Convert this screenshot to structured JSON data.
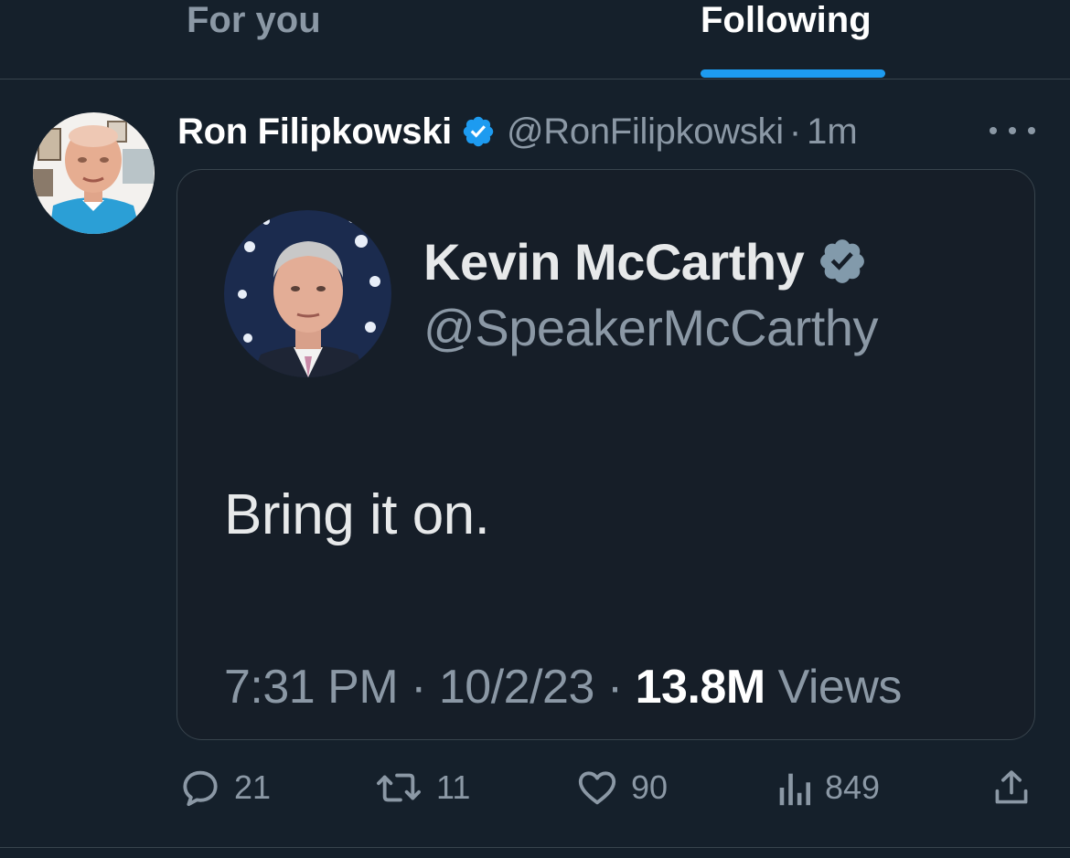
{
  "tabs": {
    "for_you": "For you",
    "following": "Following",
    "active": "following"
  },
  "tweet": {
    "author_name": "Ron Filipkowski",
    "author_handle": "@RonFilipkowski",
    "separator": "·",
    "time": "1m",
    "verified_icon": "verified-badge-icon",
    "more_icon": "more-options-icon"
  },
  "quoted_image": {
    "name": "Kevin McCarthy",
    "handle": "@SpeakerMcCarthy",
    "text": "Bring it on.",
    "time": "7:31 PM",
    "date": "10/2/23",
    "separator": "·",
    "views_count": "13.8M",
    "views_label": "Views"
  },
  "actions": {
    "reply_count": "21",
    "retweet_count": "11",
    "like_count": "90",
    "views_count": "849"
  },
  "colors": {
    "background": "#15202b",
    "accent": "#1d9bf0",
    "text_primary": "#ffffff",
    "text_secondary": "#8b98a5",
    "border": "#38444d",
    "verified_grey": "#829aab"
  }
}
